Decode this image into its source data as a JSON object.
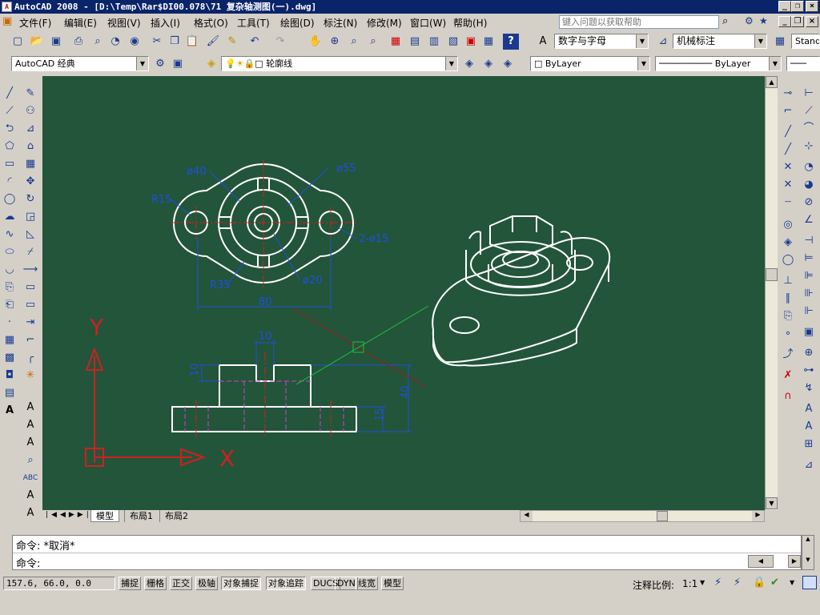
{
  "title": "AutoCAD 2008 - [D:\\Temp\\Rar$DI00.078\\71 复杂轴测图(一).dwg]",
  "menu": [
    "文件(F)",
    "编辑(E)",
    "视图(V)",
    "插入(I)",
    "格式(O)",
    "工具(T)",
    "绘图(D)",
    "标注(N)",
    "修改(M)",
    "窗口(W)",
    "帮助(H)"
  ],
  "help_placeholder": "键入问题以获取帮助",
  "toolbar": {
    "text_style": "数字与字母",
    "dim_style": "机械标注",
    "table_style": "Stand",
    "workspace": "AutoCAD 经典",
    "layer": "轮廓线",
    "color": "ByLayer",
    "linetype": "ByLayer"
  },
  "drawing": {
    "dim_phi40": "ø40",
    "dim_phi55": "ø55",
    "dim_r15": "R15",
    "dim_2phi15": "2-ø15",
    "dim_r35": "R35",
    "dim_phi20": "ø20",
    "dim_80": "80",
    "dim_10a": "10",
    "dim_10b": "10",
    "dim_40": "40",
    "dim_15": "15",
    "ucs_x": "X",
    "ucs_y": "Y"
  },
  "tabs": [
    "模型",
    "布局1",
    "布局2"
  ],
  "command": {
    "line1": "命令: *取消*",
    "line2": "命令:"
  },
  "status": {
    "coords": "157.6, 66.0, 0.0",
    "toggles": [
      "捕捉",
      "栅格",
      "正交",
      "极轴",
      "对象捕捉",
      "对象追踪",
      "DUCS",
      "DYN",
      "线宽",
      "模型"
    ],
    "annotation_scale_label": "注释比例:",
    "annotation_scale": "1:1"
  },
  "colors": {
    "canvas": "#23553a",
    "white": "#ffffff",
    "dim": "#1f4fe0",
    "center": "#d02020",
    "hidden": "#d040d0",
    "ucs": "#d02020"
  }
}
